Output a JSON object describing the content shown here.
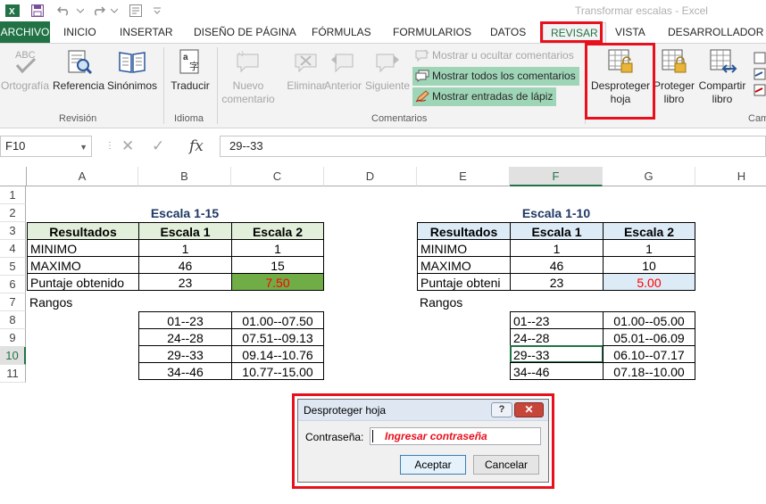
{
  "window": {
    "title": "Transformar escalas - Excel"
  },
  "ribbon_tabs": [
    "ARCHIVO",
    "INICIO",
    "INSERTAR",
    "DISEÑO DE PÁGINA",
    "FÓRMULAS",
    "FORMULARIOS",
    "DATOS",
    "REVISAR",
    "VISTA",
    "DESARROLLADOR"
  ],
  "ribbon": {
    "groups": {
      "revision": "Revisión",
      "idioma": "Idioma",
      "comentarios": "Comentarios",
      "cambios_partial": "Cam"
    },
    "buttons": {
      "ortografia": "Ortografía",
      "referencia": "Referencia",
      "sinonimos": "Sinónimos",
      "traducir": "Traducir",
      "nuevo_comentario_1": "Nuevo",
      "nuevo_comentario_2": "comentario",
      "eliminar": "Eliminar",
      "anterior": "Anterior",
      "siguiente": "Siguiente",
      "mostrar_ocultar": "Mostrar u ocultar comentarios",
      "mostrar_todos": "Mostrar todos los comentarios",
      "mostrar_lapiz": "Mostrar entradas de lápiz",
      "desproteger_1": "Desproteger",
      "desproteger_2": "hoja",
      "proteger_1": "Proteger",
      "proteger_2": "libro",
      "compartir_1": "Compartir",
      "compartir_2": "libro"
    }
  },
  "formula_bar": {
    "name_box": "F10",
    "fx": "fx",
    "formula": "29--33"
  },
  "columns": [
    "A",
    "B",
    "C",
    "D",
    "E",
    "F",
    "G",
    "H"
  ],
  "rows": [
    "1",
    "2",
    "3",
    "4",
    "5",
    "6",
    "7",
    "8",
    "9",
    "10",
    "11"
  ],
  "sheet": {
    "left": {
      "title": "Escala 1-15",
      "headers": [
        "Resultados",
        "Escala 1",
        "Escala 2"
      ],
      "rows": [
        [
          "MINIMO",
          "1",
          "1"
        ],
        [
          "MAXIMO",
          "46",
          "15"
        ],
        [
          "Puntaje obtenido",
          "23",
          "7.50"
        ]
      ],
      "rangos_label": "Rangos",
      "rangos": [
        [
          "01--23",
          "01.00--07.50"
        ],
        [
          "24--28",
          "07.51--09.13"
        ],
        [
          "29--33",
          "09.14--10.76"
        ],
        [
          "34--46",
          "10.77--15.00"
        ]
      ]
    },
    "right": {
      "title": "Escala 1-10",
      "headers": [
        "Resultados",
        "Escala 1",
        "Escala 2"
      ],
      "rows": [
        [
          "MINIMO",
          "1",
          "1"
        ],
        [
          "MAXIMO",
          "46",
          "10"
        ],
        [
          "Puntaje obteni",
          "23",
          "5.00"
        ]
      ],
      "rangos_label": "Rangos",
      "rangos": [
        [
          "01--23",
          "01.00--05.00"
        ],
        [
          "24--28",
          "05.01--06.09"
        ],
        [
          "29--33",
          "06.10--07.17"
        ],
        [
          "34--46",
          "07.18--10.00"
        ]
      ]
    }
  },
  "dialog": {
    "title": "Desproteger hoja",
    "help": "?",
    "close": "✕",
    "password_label": "Contraseña:",
    "password_hint": "Ingresar contraseña",
    "accept": "Aceptar",
    "cancel": "Cancelar"
  },
  "colors": {
    "excel_green": "#217346",
    "highlight_red": "#e8101c",
    "green_fill": "#70ad47",
    "light_green": "#e2efda",
    "light_blue": "#ddebf7"
  }
}
